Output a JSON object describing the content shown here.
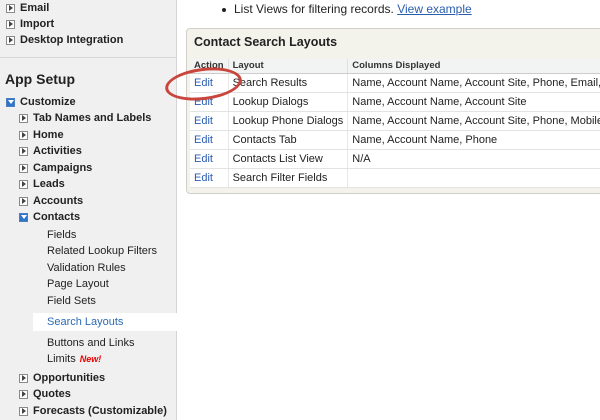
{
  "sidebar": {
    "top_items": [
      {
        "label": "Email"
      },
      {
        "label": "Import"
      },
      {
        "label": "Desktop Integration"
      }
    ],
    "app_setup": "App Setup",
    "customize": "Customize",
    "customize_items": [
      {
        "label": "Tab Names and Labels"
      },
      {
        "label": "Home"
      },
      {
        "label": "Activities"
      },
      {
        "label": "Campaigns"
      },
      {
        "label": "Leads"
      },
      {
        "label": "Accounts"
      },
      {
        "label": "Contacts"
      }
    ],
    "contacts_items": [
      {
        "label": "Fields"
      },
      {
        "label": "Related Lookup Filters"
      },
      {
        "label": "Validation Rules"
      },
      {
        "label": "Page Layout"
      },
      {
        "label": "Field Sets"
      },
      {
        "label": "Search Layouts"
      },
      {
        "label": "Buttons and Links"
      },
      {
        "label": "Limits"
      }
    ],
    "new_badge": "New!",
    "bottom_items": [
      {
        "label": "Opportunities"
      },
      {
        "label": "Quotes"
      },
      {
        "label": "Forecasts (Customizable)"
      }
    ]
  },
  "main": {
    "note_text": "List Views for filtering records.",
    "note_link": "View example",
    "panel_title": "Contact Search Layouts",
    "columns": [
      "Action",
      "Layout",
      "Columns Displayed"
    ],
    "rows": [
      {
        "action": "Edit",
        "layout": "Search Results",
        "columns": "Name, Account Name, Account Site, Phone, Email, Co"
      },
      {
        "action": "Edit",
        "layout": "Lookup Dialogs",
        "columns": "Name, Account Name, Account Site"
      },
      {
        "action": "Edit",
        "layout": "Lookup Phone Dialogs",
        "columns": "Name, Account Name, Account Site, Phone, Mobile, H"
      },
      {
        "action": "Edit",
        "layout": "Contacts Tab",
        "columns": "Name, Account Name, Phone"
      },
      {
        "action": "Edit",
        "layout": "Contacts List View",
        "columns": "N/A"
      },
      {
        "action": "Edit",
        "layout": "Search Filter Fields",
        "columns": ""
      }
    ]
  }
}
